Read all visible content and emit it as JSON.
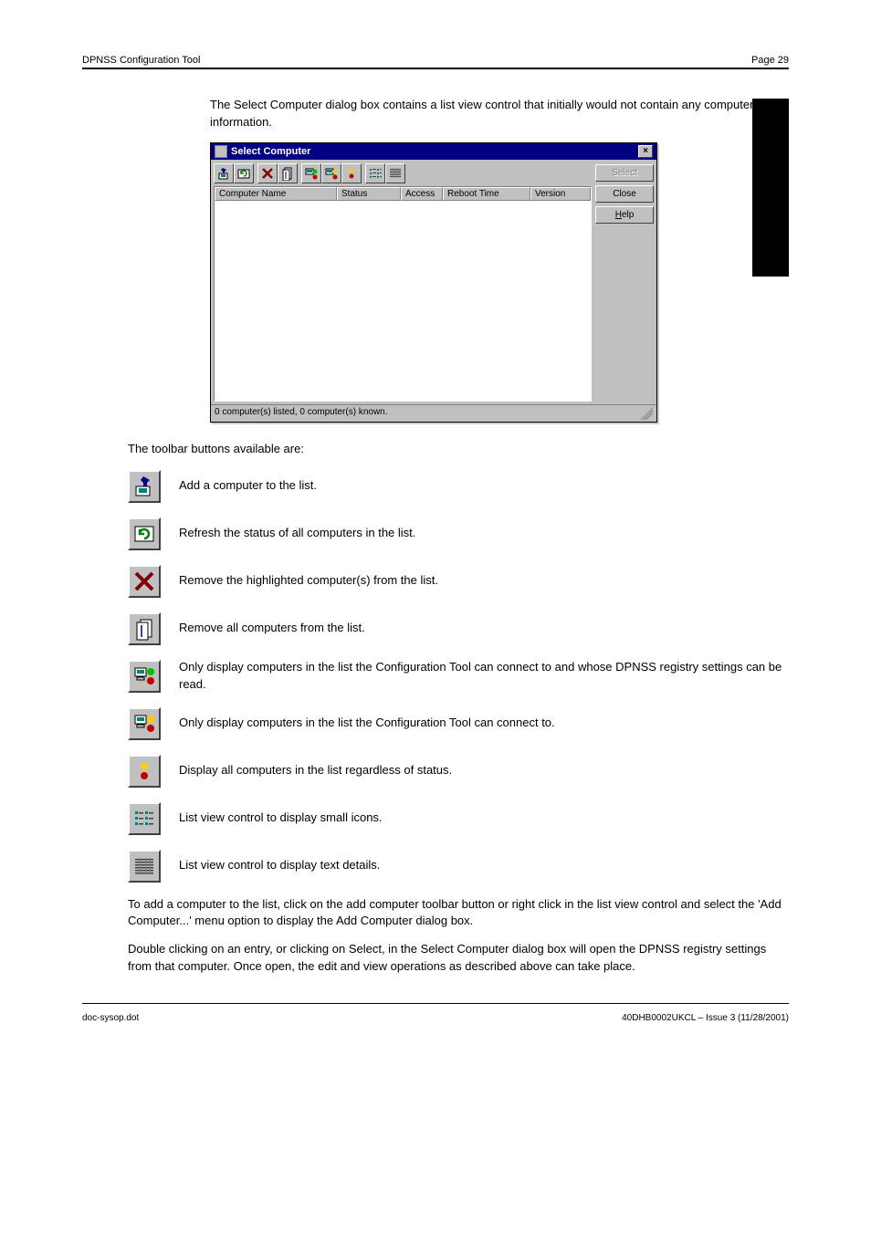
{
  "header": {
    "left": "DPNSS Configuration Tool",
    "page": "Page 29"
  },
  "intro": "The Select Computer dialog box contains a list view control that initially would not contain any computer information.",
  "dialog": {
    "title": "Select Computer",
    "columns": [
      "Computer Name",
      "Status",
      "Access",
      "Reboot Time",
      "Version"
    ],
    "buttons": {
      "select": "Select",
      "close": "Close",
      "help": "Help"
    },
    "status": "0 computer(s) listed, 0 computer(s) known."
  },
  "toolbar_intro": "The toolbar buttons available are:",
  "icons": [
    {
      "label": "Add a computer to the list."
    },
    {
      "label": "Refresh the status of all computers in the list."
    },
    {
      "label": "Remove the highlighted computer(s) from the list."
    },
    {
      "label": "Remove all computers from the list."
    },
    {
      "label": "Only display computers in the list the Configuration Tool can connect to and whose DPNSS registry settings can be read."
    },
    {
      "label": "Only display computers in the list the Configuration Tool can connect to."
    },
    {
      "label": "Display all computers in the list regardless of status."
    },
    {
      "label": "List view control to display small icons."
    },
    {
      "label": "List view control to display text details."
    }
  ],
  "closing": [
    "To add a computer to the list, click on the add computer toolbar button or right click in the list view control and select the 'Add Computer...' menu option to display the Add Computer dialog box.",
    "Double clicking on an entry, or clicking on Select, in the Select Computer dialog box will open the DPNSS registry settings from that computer. Once open, the edit and view operations as described above can take place."
  ],
  "footer": {
    "left": "doc-sysop.dot",
    "right": "40DHB0002UKCL – Issue 3 (11/28/2001)"
  }
}
